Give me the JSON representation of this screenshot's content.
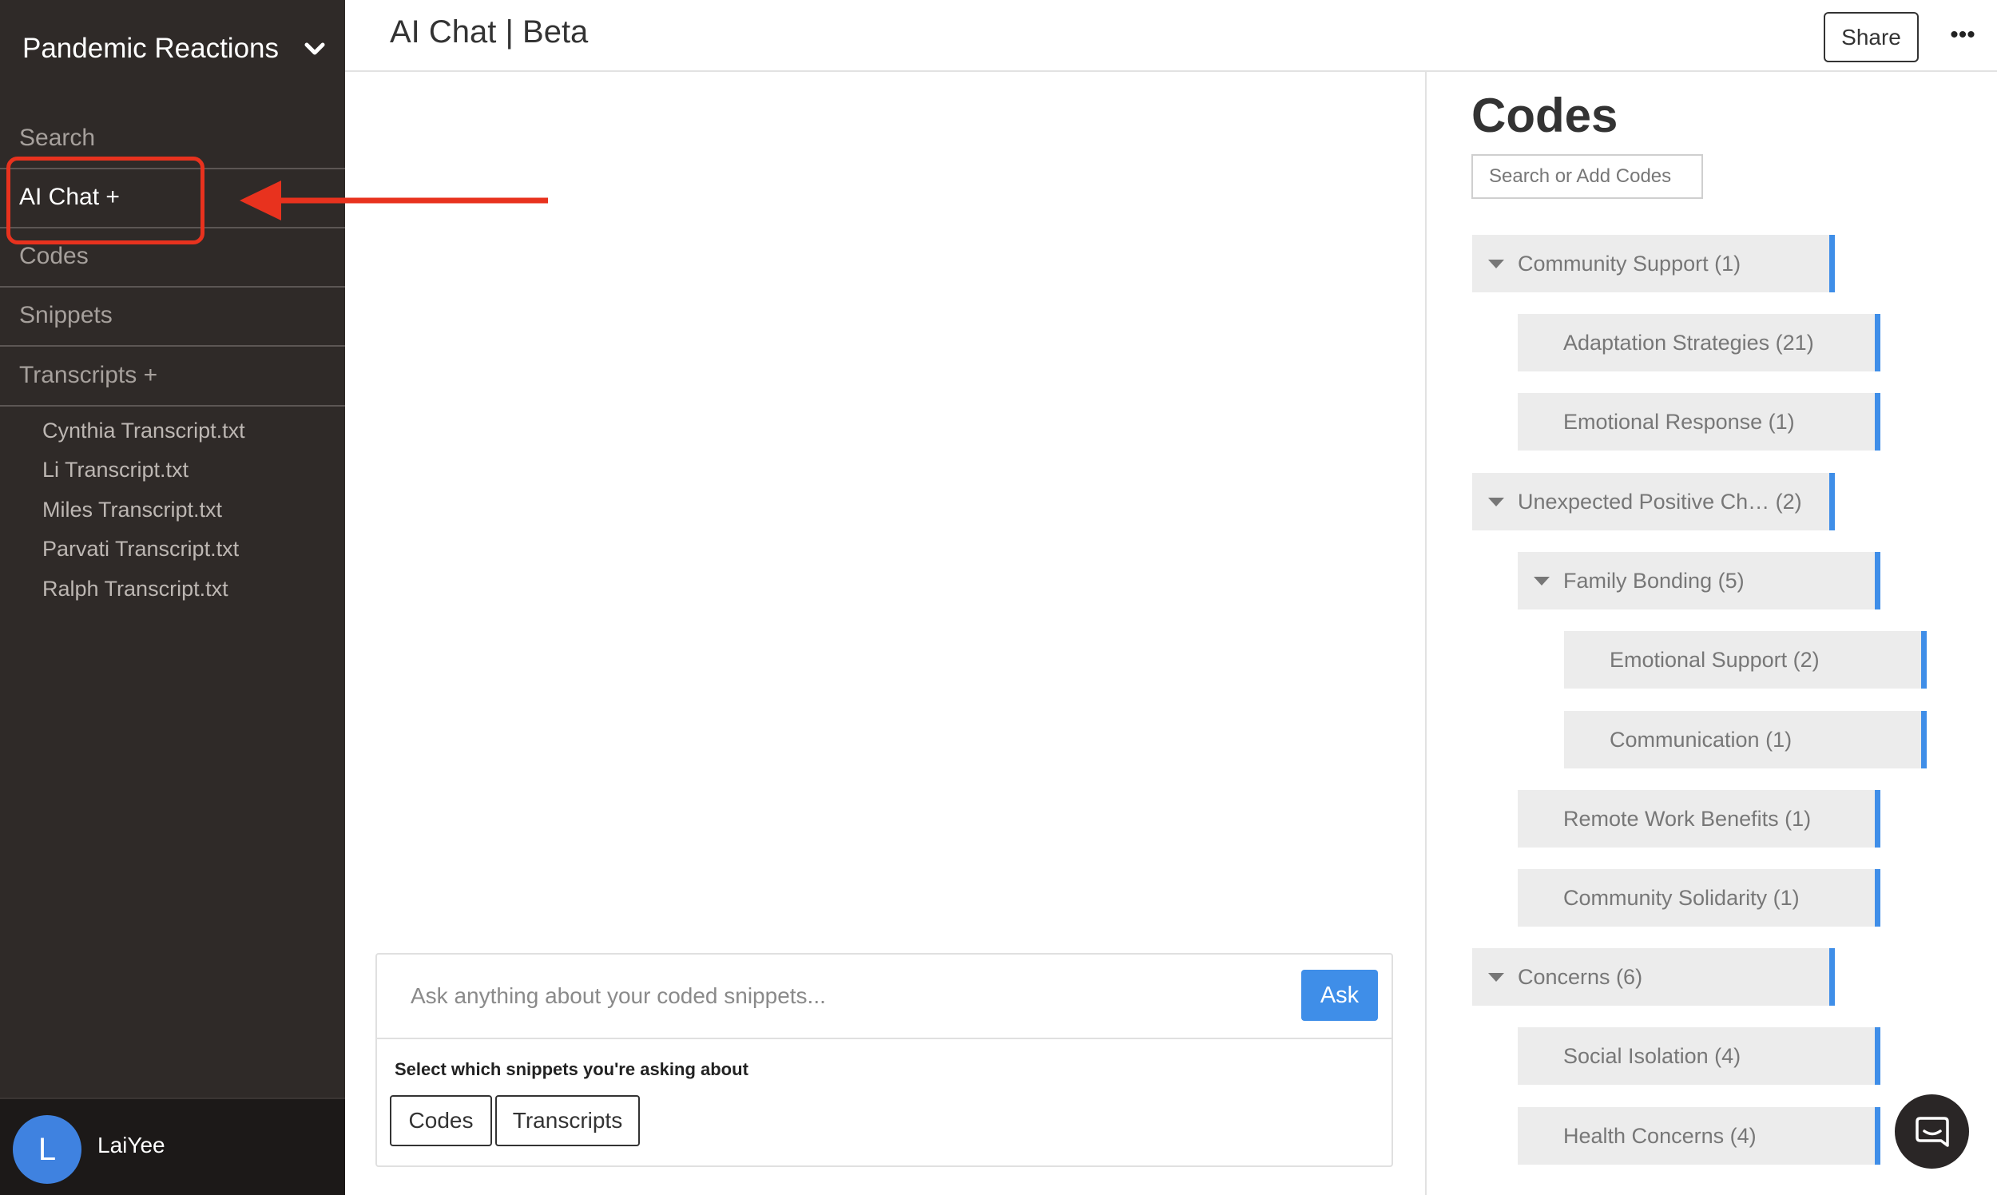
{
  "sidebar": {
    "project_title": "Pandemic Reactions",
    "nav": [
      "Search",
      "AI Chat +",
      "Codes",
      "Snippets",
      "Transcripts +"
    ],
    "files": [
      "Cynthia Transcript.txt",
      "Li Transcript.txt",
      "Miles Transcript.txt",
      "Parvati Transcript.txt",
      "Ralph Transcript.txt"
    ],
    "user": {
      "initial": "L",
      "name": "LaiYee"
    }
  },
  "header": {
    "title": "AI Chat | Beta",
    "share_label": "Share",
    "more_label": "•••"
  },
  "chat": {
    "placeholder": "Ask anything about your coded snippets...",
    "ask_label": "Ask",
    "select_label": "Select which snippets you're asking about",
    "scope_buttons": [
      "Codes",
      "Transcripts"
    ]
  },
  "codes_panel": {
    "title": "Codes",
    "search_placeholder": "Search or Add Codes",
    "items": [
      {
        "label": "Community Support (1)",
        "level": 0,
        "expandable": true
      },
      {
        "label": "Adaptation Strategies (21)",
        "level": 1,
        "expandable": false
      },
      {
        "label": "Emotional Response (1)",
        "level": 1,
        "expandable": false
      },
      {
        "label": "Unexpected Positive Ch…  (2)",
        "level": 0,
        "expandable": true
      },
      {
        "label": "Family Bonding (5)",
        "level": 1,
        "expandable": true
      },
      {
        "label": "Emotional Support (2)",
        "level": 2,
        "expandable": false
      },
      {
        "label": "Communication (1)",
        "level": 2,
        "expandable": false
      },
      {
        "label": "Remote Work Benefits (1)",
        "level": 1,
        "expandable": false
      },
      {
        "label": "Community Solidarity (1)",
        "level": 1,
        "expandable": false
      },
      {
        "label": "Concerns (6)",
        "level": 0,
        "expandable": true
      },
      {
        "label": "Social Isolation (4)",
        "level": 1,
        "expandable": false
      },
      {
        "label": "Health Concerns (4)",
        "level": 1,
        "expandable": false
      }
    ],
    "accent_color": "#3f8ee8"
  },
  "colors": {
    "sidebar_bg": "#2f2a28",
    "annotation_red": "#e8321e",
    "ask_button": "#3f8ee8"
  }
}
